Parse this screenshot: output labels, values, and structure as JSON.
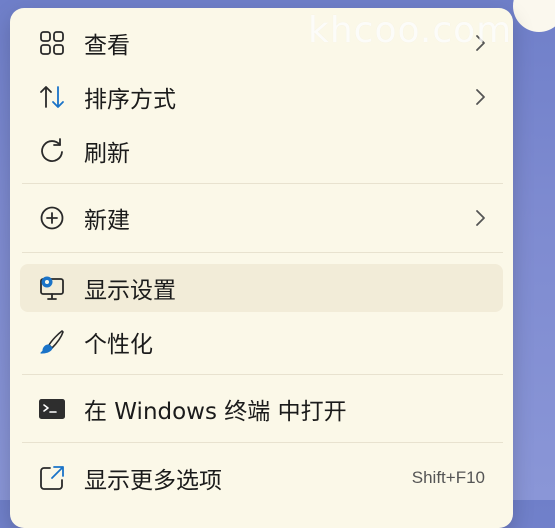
{
  "watermark": "khcoo.com",
  "menu": {
    "items": [
      {
        "label": "查看",
        "icon": "grid-view-icon",
        "submenu": true
      },
      {
        "label": "排序方式",
        "icon": "sort-arrows-icon",
        "submenu": true
      },
      {
        "label": "刷新",
        "icon": "refresh-icon",
        "submenu": false
      },
      {
        "label": "新建",
        "icon": "add-circle-icon",
        "submenu": true
      },
      {
        "label": "显示设置",
        "icon": "display-settings-icon",
        "submenu": false
      },
      {
        "label": "个性化",
        "icon": "paintbrush-icon",
        "submenu": false
      },
      {
        "label": "在 Windows 终端 中打开",
        "icon": "terminal-icon",
        "submenu": false
      },
      {
        "label": "显示更多选项",
        "icon": "open-external-icon",
        "submenu": false,
        "shortcut": "Shift+F10"
      }
    ]
  },
  "colors": {
    "menu_bg": "#fbf8e8",
    "hover_bg": "#f2ecd8",
    "accent": "#1a73c8"
  }
}
